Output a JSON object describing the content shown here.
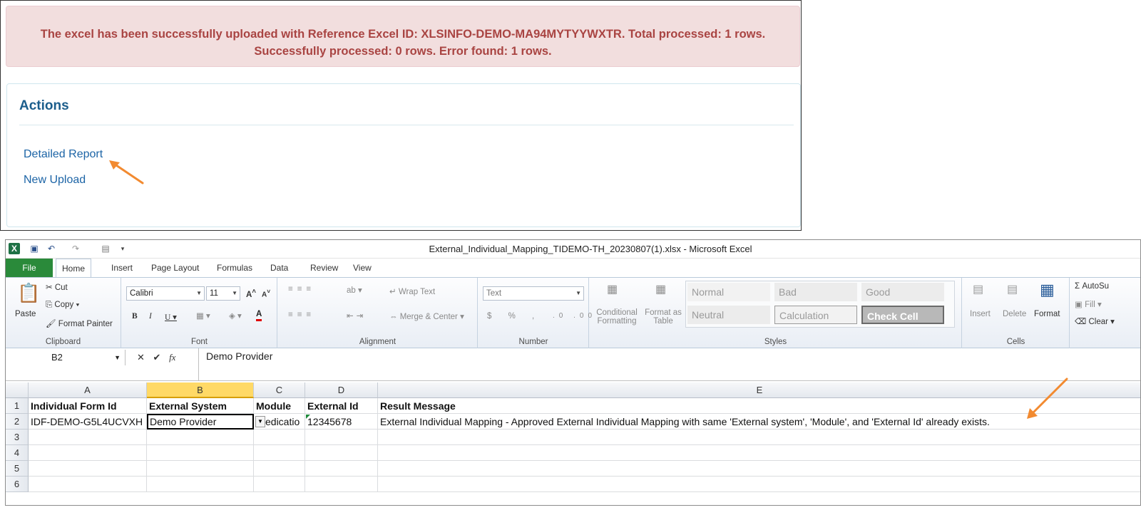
{
  "alert": {
    "line1": "The excel has been successfully uploaded with Reference Excel ID: XLSINFO-DEMO-MA94MYTYYWXTR. Total processed: 1 rows.",
    "line2": "Successfully processed: 0 rows. Error found: 1 rows."
  },
  "actions": {
    "title": "Actions",
    "links": [
      "Detailed Report",
      "New Upload"
    ]
  },
  "excel": {
    "window_title": "External_Individual_Mapping_TIDEMO-TH_20230807(1).xlsx  -  Microsoft Excel",
    "tabs": [
      "File",
      "Home",
      "Insert",
      "Page Layout",
      "Formulas",
      "Data",
      "Review",
      "View"
    ],
    "ribbon": {
      "clipboard": {
        "paste": "Paste",
        "cut": "Cut",
        "copy": "Copy",
        "format_painter": "Format Painter",
        "label": "Clipboard"
      },
      "font": {
        "name": "Calibri",
        "size": "11",
        "label": "Font"
      },
      "alignment": {
        "wrap_text": "Wrap Text",
        "merge_center": "Merge & Center",
        "label": "Alignment"
      },
      "number": {
        "format": "Text",
        "label": "Number"
      },
      "styles": {
        "conditional": "Conditional",
        "formatting": "Formatting",
        "format_as": "Format as",
        "table": "Table",
        "boxes": [
          "Normal",
          "Bad",
          "Good",
          "Neutral",
          "Calculation",
          "Check Cell"
        ],
        "label": "Styles"
      },
      "cells": {
        "insert": "Insert",
        "delete": "Delete",
        "format": "Format",
        "label": "Cells"
      },
      "editing": {
        "autosum": "AutoSu",
        "fill": "Fill",
        "clear": "Clear"
      }
    },
    "name_box": "B2",
    "formula": "Demo Provider",
    "columns": [
      "A",
      "B",
      "C",
      "D",
      "E"
    ],
    "rows": [
      "1",
      "2",
      "3",
      "4",
      "5",
      "6"
    ],
    "headers": [
      "Individual Form Id",
      "External System",
      "Module",
      "External Id",
      "Result Message"
    ],
    "row2": [
      "IDF-DEMO-G5L4UCVXH",
      "Demo Provider",
      "edicatio",
      "12345678",
      "External Individual Mapping - Approved External Individual Mapping with same 'External system', 'Module', and 'External Id' already exists."
    ]
  },
  "colors": {
    "alert_bg": "#f2dede",
    "alert_text": "#a94442",
    "link": "#1c64a6",
    "arrow": "#f28a30",
    "excel_green": "#2a8a3a"
  }
}
